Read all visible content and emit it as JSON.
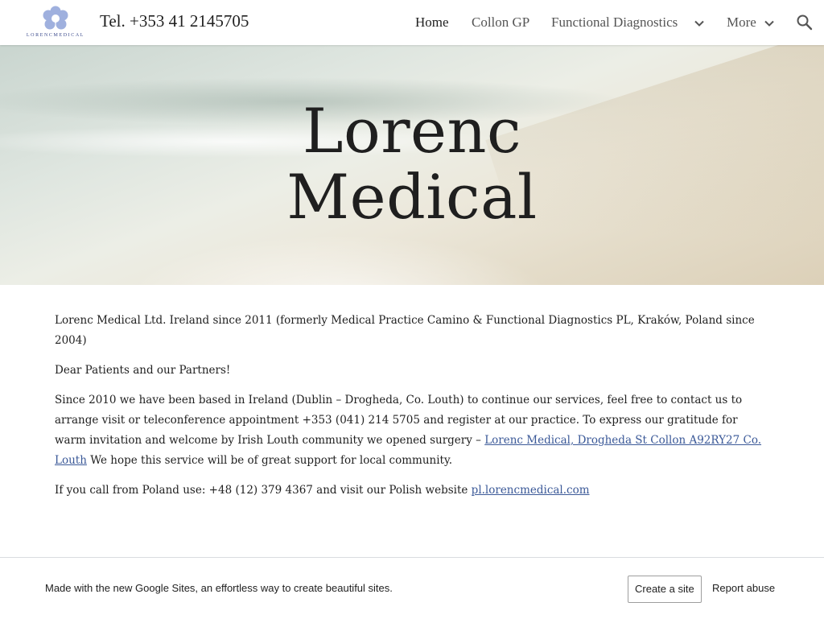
{
  "header": {
    "logo_text": "LORENCMEDICAL",
    "site_title": "Tel. +353 41 2145705",
    "nav": [
      {
        "label": "Home",
        "active": true
      },
      {
        "label": "Collon GP"
      },
      {
        "label": "Functional Diagnostics",
        "dropdown": true
      },
      {
        "label": "More",
        "dropdown": true
      }
    ],
    "search_icon": "search-icon"
  },
  "hero": {
    "title_line1": "Lorenc",
    "title_line2": "Medical"
  },
  "content": {
    "p1": "Lorenc Medical Ltd. Ireland since 2011 (formerly Medical Practice Camino & Functional Diagnostics PL, Kraków, Poland since 2004)",
    "p2": "Dear Patients and our Partners!",
    "p3_before": "Since 2010 we have been based in Ireland (Dublin – Drogheda, Co. Louth) to continue our services, feel free to contact us to arrange visit or teleconference appointment +353 (041) 214 5705 and register at our practice. To express our gratitude for warm invitation and welcome by Irish Louth community we opened surgery – ",
    "p3_link": "Lorenc Medical, Drogheda St Collon A92RY27 Co. Louth",
    "p3_after": " We hope this service will be of great support for local community.",
    "p4_before": "If you call from Poland use: +48 (12) 379 4367 and visit our Polish website ",
    "p4_link": "pl.lorencmedical.com"
  },
  "footer": {
    "text": "Made with the new Google Sites, an effortless way to create beautiful sites.",
    "create_label": "Create a site",
    "report_label": "Report abuse"
  },
  "colors": {
    "link": "#3b5998",
    "logo_blue": "#8fa3d9",
    "text": "#212121"
  }
}
